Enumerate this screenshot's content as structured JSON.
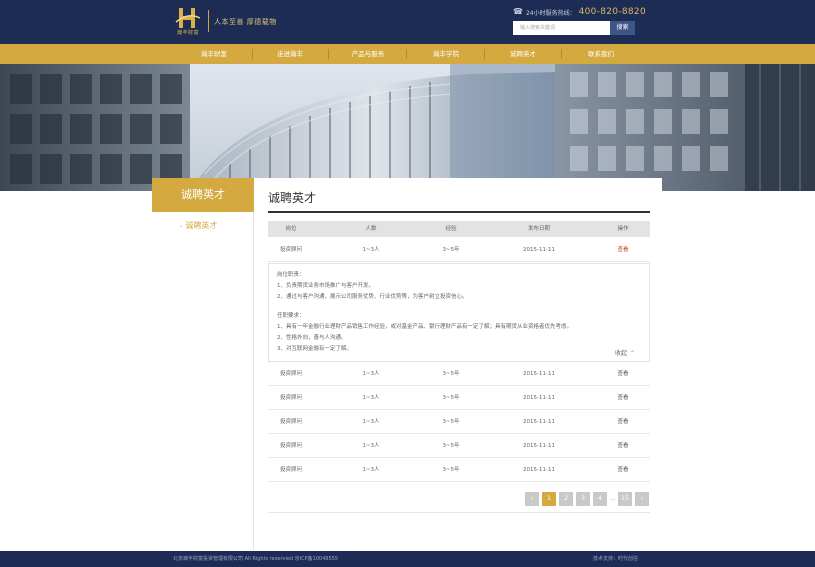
{
  "header": {
    "logo_text": "瀚丰财富",
    "slogan": "人本至善 厚德载物",
    "hotline_label": "24小时服务热线：",
    "hotline_number": "400-820-8820",
    "search_placeholder": "输入搜索关键词",
    "search_button": "搜索"
  },
  "nav": [
    "瀚丰财富",
    "走进瀚丰",
    "产品与服务",
    "瀚丰学院",
    "诚聘英才",
    "联系我们"
  ],
  "sidebar": {
    "title": "诚聘英才",
    "item": "诚聘英才"
  },
  "main": {
    "title": "诚聘英才",
    "columns": [
      "岗位",
      "人数",
      "经验",
      "发布日期",
      "操作"
    ],
    "rows": [
      {
        "position": "投资顾问",
        "count": "1~3人",
        "experience": "3~5年",
        "date": "2015-11-11",
        "action": "查看"
      },
      {
        "position": "投资顾问",
        "count": "1~3人",
        "experience": "3~5年",
        "date": "2015-11-11",
        "action": "查看"
      },
      {
        "position": "投资顾问",
        "count": "1~3人",
        "experience": "3~5年",
        "date": "2015-11-11",
        "action": "查看"
      },
      {
        "position": "投资顾问",
        "count": "1~3人",
        "experience": "3~5年",
        "date": "2015-11-11",
        "action": "查看"
      },
      {
        "position": "投资顾问",
        "count": "1~3人",
        "experience": "3~5年",
        "date": "2015-11-11",
        "action": "查看"
      },
      {
        "position": "投资顾问",
        "count": "1~3人",
        "experience": "3~5年",
        "date": "2015-11-11",
        "action": "查看"
      }
    ],
    "detail": {
      "duties_title": "岗位职责：",
      "duties": [
        "1、负责期货业务市场推广与客户开发。",
        "2、通过与客户沟通，展示公司服务优势、行业优势等，为客户树立投资信心。"
      ],
      "requirements_title": "任职要求：",
      "requirements": [
        "1、具有一年金融行业理财产品销售工作经验，或对基金产品、银行理财产品有一定了解；具有期货从业资格者优先考虑。",
        "2、性格外向，善与人沟通。",
        "3、对互联网金融有一定了解。"
      ],
      "collapse_label": "收起"
    },
    "pagination": {
      "pages": [
        "1",
        "2",
        "3",
        "4"
      ],
      "ellipsis": "...",
      "last": "15",
      "active": "1"
    }
  },
  "footer": {
    "copyright": "北京瀚丰财富投资管理有限公司 All Rights reservied 京ICP备10048555",
    "tech_support": "技术支持：时代创信"
  },
  "colors": {
    "navy": "#1c2c54",
    "gold": "#d4a93f",
    "action_active": "#c0392b"
  },
  "icons": [
    "phone-icon",
    "chevron-right-icon",
    "chevron-left-icon",
    "chevron-up-icon"
  ]
}
